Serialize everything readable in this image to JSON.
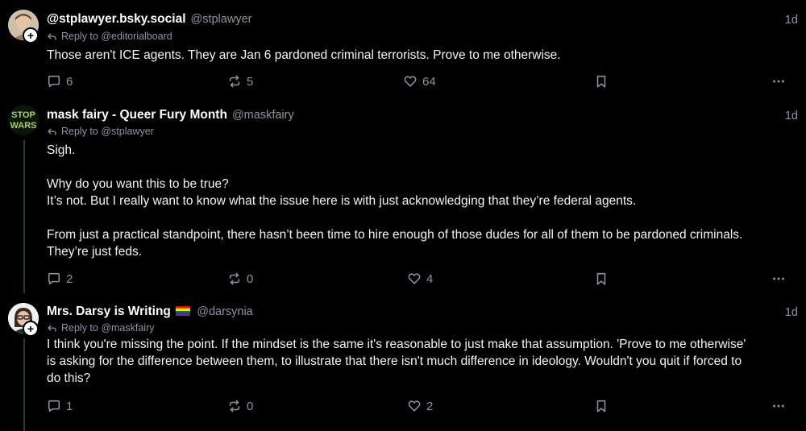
{
  "posts": [
    {
      "display_name": "@stplawyer.bsky.social",
      "handle": "@stplawyer",
      "time": "1d",
      "reply_to": "Reply to @editorialboard",
      "body": [
        "Those aren't ICE agents. They are Jan 6 pardoned criminal terrorists. Prove to me otherwise."
      ],
      "replies": "6",
      "reposts": "5",
      "likes": "64"
    },
    {
      "display_name": "mask fairy - Queer Fury Month",
      "handle": "@maskfairy",
      "time": "1d",
      "reply_to": "Reply to @stplawyer",
      "avatar_text": "STOP WARS",
      "body": [
        "Sigh.",
        "",
        "Why do you want this to be true?",
        "It’s not. But I really want to know what the issue here is with just acknowledging that they’re federal agents.",
        "",
        "From just a practical standpoint, there hasn’t been time to hire enough of those dudes for all of them to be pardoned criminals.",
        "They’re just feds."
      ],
      "replies": "2",
      "reposts": "0",
      "likes": "4"
    },
    {
      "display_name": "Mrs. Darsy is Writing",
      "handle": "@darsynia",
      "time": "1d",
      "reply_to": "Reply to @maskfairy",
      "body": [
        "I think you're missing the point. If the mindset is the same it's reasonable to just make that assumption. 'Prove to me otherwise'",
        "is asking for the difference between them, to illustrate that there isn't much difference in ideology. Wouldn't you quit if forced to",
        "do this?"
      ],
      "replies": "1",
      "reposts": "0",
      "likes": "2"
    }
  ],
  "icons": {
    "reply": "speech-bubble-icon",
    "repost": "repost-arrows-icon",
    "like": "heart-icon",
    "bookmark": "bookmark-icon",
    "more": "ellipsis-icon",
    "reply_to": "reply-arrow-icon"
  },
  "colors": {
    "background": "#000000",
    "muted": "#8b95a5",
    "text": "#f1f3f5"
  }
}
